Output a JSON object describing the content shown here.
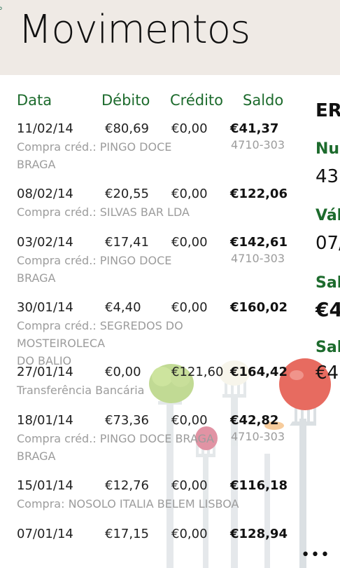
{
  "header": {
    "title": "Movimentos"
  },
  "columns": {
    "data": "Data",
    "debito": "Débito",
    "credito": "Crédito",
    "saldo": "Saldo"
  },
  "transactions": [
    {
      "date": "11/02/14",
      "debit": "€80,69",
      "credit": "€0,00",
      "balance": "€41,37",
      "desc": "Compra créd.: PINGO DOCE\nBRAGA",
      "loc": "4710-303"
    },
    {
      "date": "08/02/14",
      "debit": "€20,55",
      "credit": "€0,00",
      "balance": "€122,06",
      "desc": "Compra créd.: SILVAS BAR LDA",
      "loc": ""
    },
    {
      "date": "03/02/14",
      "debit": "€17,41",
      "credit": "€0,00",
      "balance": "€142,61",
      "desc": "Compra créd.: PINGO DOCE\nBRAGA",
      "loc": "4710-303"
    },
    {
      "date": "30/01/14",
      "debit": "€4,40",
      "credit": "€0,00",
      "balance": "€160,02",
      "desc": "Compra créd.: SEGREDOS DO MOSTEIROLECA\nDO BALIO",
      "loc": ""
    },
    {
      "date": "27/01/14",
      "debit": "€0,00",
      "credit": "€121,60",
      "balance": "€164,42",
      "desc": "Transferência Bancária",
      "loc": ""
    },
    {
      "date": "18/01/14",
      "debit": "€73,36",
      "credit": "€0,00",
      "balance": "€42,82",
      "desc": "Compra créd.: PINGO DOCE BRAGA\nBRAGA",
      "loc": "4710-303"
    },
    {
      "date": "15/01/14",
      "debit": "€12,76",
      "credit": "€0,00",
      "balance": "€116,18",
      "desc": "Compra: NOSOLO ITALIA BELEM LISBOA",
      "loc": ""
    },
    {
      "date": "07/01/14",
      "debit": "€17,15",
      "credit": "€0,00",
      "balance": "€128,94",
      "desc": "",
      "loc": ""
    }
  ],
  "side_panel": {
    "title": "ER",
    "num_label": "Nu",
    "num_value": "43",
    "valid_label": "Vál",
    "valid_value": "07/",
    "saldo_label": "Sal",
    "saldo_value": "€4",
    "saldo2_label": "Sal",
    "saldo2_value": "€4"
  },
  "appbar": {
    "more": "•••"
  },
  "colors": {
    "accent": "#1d6b2d",
    "header_bg": "#efeae5"
  },
  "icons": {
    "background": "forks-with-vegetables-illustration"
  }
}
